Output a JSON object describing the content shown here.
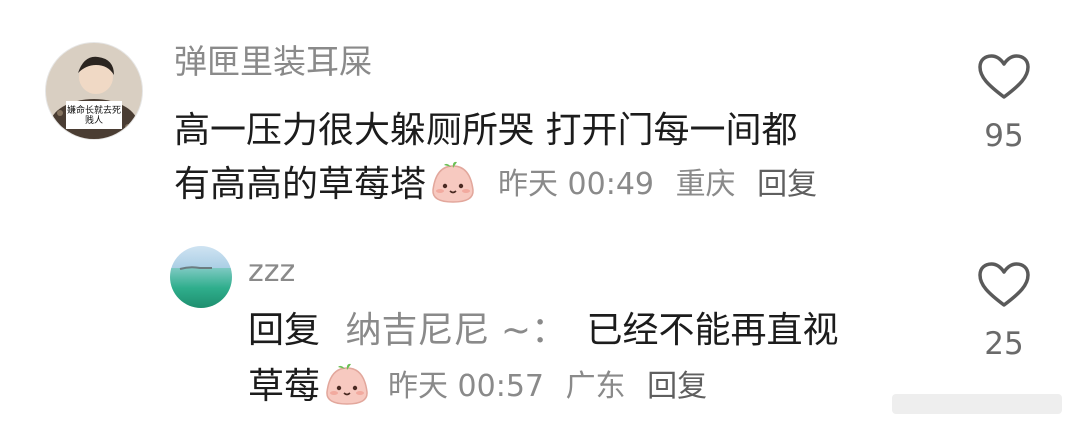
{
  "comment": {
    "username": "弹匣里装耳屎",
    "text_line1": "高一压力很大躲厕所哭 打开门每一间都",
    "text_line2": "有高高的草莓塔",
    "time": "昨天 00:49",
    "location": "重庆",
    "reply_label": "回复",
    "like_count": "95",
    "avatar_text_line1": "嫌命长就去死",
    "avatar_text_line2": "贱人"
  },
  "reply": {
    "username": "zzz",
    "prefix": "回复",
    "mention": "纳吉尼尼 ~：",
    "text_line1": "已经不能再直视",
    "text_line2": "草莓",
    "time": "昨天 00:57",
    "location": "广东",
    "reply_label": "回复",
    "like_count": "25"
  },
  "icons": {
    "like": "heart-outline-icon",
    "emoji": "strawberry-blob-emoji-icon"
  },
  "colors": {
    "text_primary": "#1c1c1c",
    "text_secondary": "#8a8a8a",
    "icon_gray": "#5a5a5a",
    "emoji_fill": "#f7c9c0"
  }
}
